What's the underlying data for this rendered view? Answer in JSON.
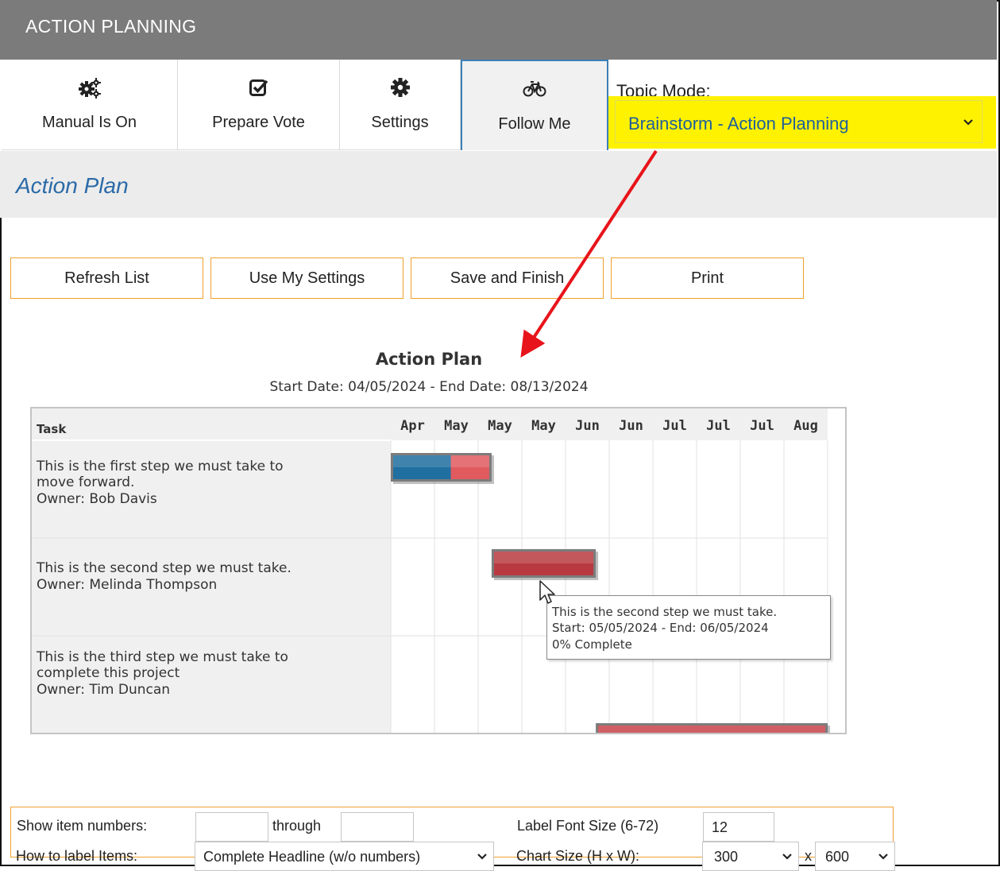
{
  "header": {
    "title": "ACTION PLANNING"
  },
  "toolbar": {
    "manual": "Manual Is On",
    "prepare_vote": "Prepare Vote",
    "settings": "Settings",
    "follow_me": "Follow Me",
    "topic_label": "Topic Mode:",
    "topic_value": "Brainstorm - Action Planning"
  },
  "section": {
    "title": "Action Plan"
  },
  "buttons": {
    "refresh": "Refresh List",
    "use_settings": "Use My Settings",
    "save": "Save and Finish",
    "print": "Print"
  },
  "chart_data": {
    "type": "gantt",
    "title": "Action Plan",
    "subtitle": "Start Date: 04/05/2024 - End Date: 08/13/2024",
    "task_header": "Task",
    "columns": [
      "Apr",
      "May",
      "May",
      "May",
      "Jun",
      "Jun",
      "Jul",
      "Jul",
      "Jul",
      "Aug"
    ],
    "tasks": [
      {
        "lines": [
          "This is the first step we must take to",
          "move forward.",
          "Owner: Bob Davis"
        ],
        "start": "04/05/2024",
        "end": "05/05/2024",
        "complete_fraction": 0.6,
        "colors": {
          "done": "#1f6fa0",
          "remaining": "#e05a5e"
        }
      },
      {
        "lines": [
          "This is the second step we must take.",
          "Owner: Melinda Thompson"
        ],
        "start": "05/05/2024",
        "end": "06/05/2024",
        "complete_fraction": 0.0,
        "colors": {
          "done": "#1f6fa0",
          "remaining": "#b83a40"
        }
      },
      {
        "lines": [
          "This is the third step we must take to",
          "complete this project",
          "Owner: Tim Duncan"
        ],
        "start": "06/05/2024",
        "end": "08/13/2024",
        "complete_fraction": 0.0,
        "colors": {
          "done": "#1f6fa0",
          "remaining": "#c8444a"
        }
      }
    ]
  },
  "tooltip": {
    "line1": "This is the second step we must take.",
    "line2": "Start: 05/05/2024 - End: 06/05/2024",
    "line3": "0% Complete"
  },
  "settings_panel": {
    "show_items_label": "Show item numbers:",
    "from_value": "",
    "through_label": "through",
    "to_value": "",
    "font_size_label": "Label Font Size (6-72)",
    "font_size_value": "12",
    "label_items_label": "How to label Items:",
    "label_items_value": "Complete Headline (w/o numbers)",
    "chart_size_label": "Chart Size (H x W):",
    "height_value": "300",
    "x_label": "x",
    "width_value": "600"
  },
  "colors": {
    "accent_blue": "#2b6aa8",
    "highlight": "#fff200",
    "button_border": "#f0a030",
    "arrow": "#e8141b"
  }
}
